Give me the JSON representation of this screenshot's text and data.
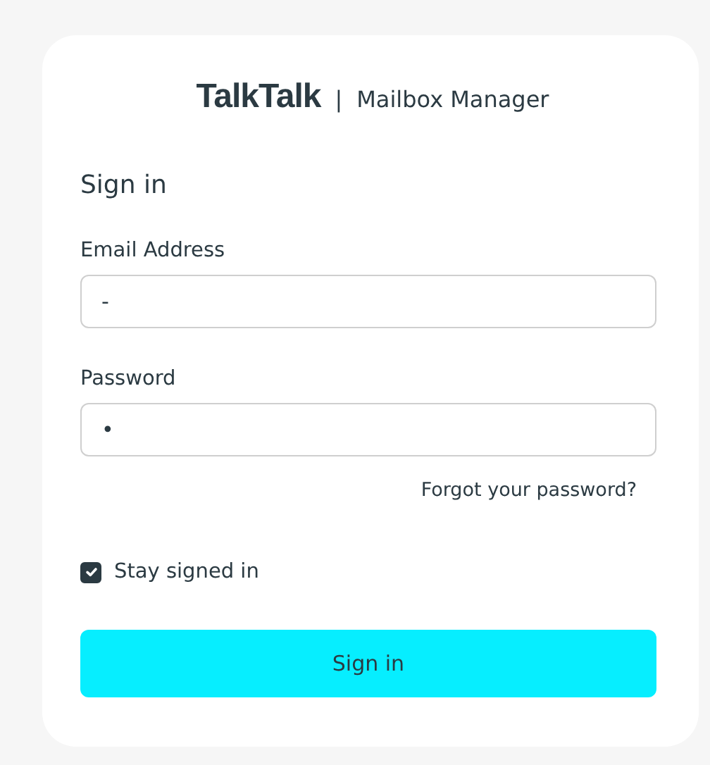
{
  "header": {
    "logo": "TalkTalk",
    "separator": "|",
    "title": "Mailbox Manager"
  },
  "heading": "Sign in",
  "fields": [
    {
      "label": "Email Address",
      "value": "-"
    },
    {
      "label": "Password",
      "value": "•"
    }
  ],
  "forgot_link": "Forgot your password?",
  "stay_signed_in": {
    "label": "Stay signed in",
    "checked": true
  },
  "submit_button": "Sign in"
}
